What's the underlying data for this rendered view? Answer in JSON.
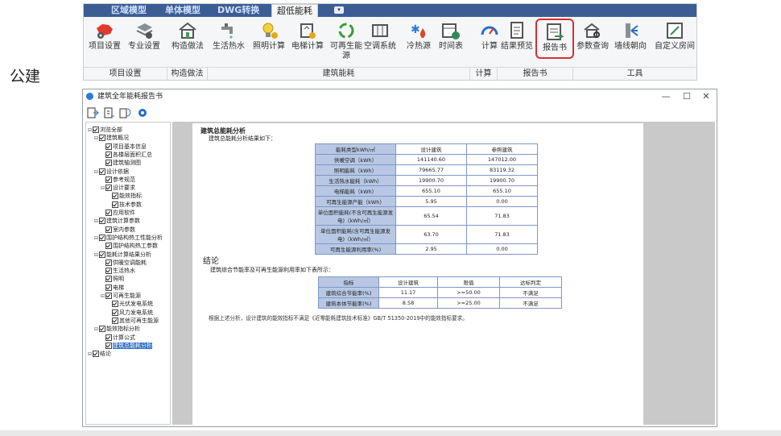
{
  "ribbon": {
    "tabs": [
      "区域模型",
      "单体模型",
      "DWG转换",
      "超低能耗"
    ],
    "buttons": [
      {
        "label": "项目设置",
        "icon": "china-map-gear-icon"
      },
      {
        "label": "专业设置",
        "icon": "layers-gear-icon"
      },
      {
        "label": "构造做法",
        "icon": "house-icon"
      },
      {
        "label": "生活热水",
        "icon": "faucet-icon"
      },
      {
        "label": "照明计算",
        "icon": "bulb-icon"
      },
      {
        "label": "电梯计算",
        "icon": "elevator-icon"
      },
      {
        "label": "可再生能源",
        "icon": "recycle-icon"
      },
      {
        "label": "空调系统",
        "icon": "ac-icon"
      },
      {
        "label": "冷热源",
        "icon": "snow-fire-icon"
      },
      {
        "label": "时间表",
        "icon": "calendar-clock-icon"
      },
      {
        "label": "计算",
        "icon": "gauge-icon"
      },
      {
        "label": "结果预览",
        "icon": "preview-icon"
      },
      {
        "label": "报告书",
        "icon": "report-icon"
      },
      {
        "label": "参数查询",
        "icon": "house-search-icon"
      },
      {
        "label": "墙线朝向",
        "icon": "wall-direction-icon"
      },
      {
        "label": "自定义房间",
        "icon": "custom-room-icon"
      }
    ],
    "groups": [
      "项目设置",
      "构造做法",
      "建筑能耗",
      "计算",
      "报告书",
      "工具"
    ],
    "extra_tab": "▾"
  },
  "side_label": "公建",
  "window": {
    "title": "建筑全年能耗报告书",
    "controls": [
      "—",
      "☐",
      "✕"
    ],
    "tree": [
      {
        "label": "浏览全部",
        "lvl": 0,
        "exp": "⊟"
      },
      {
        "label": "建筑概况",
        "lvl": 1,
        "exp": "⊟"
      },
      {
        "label": "项目基本信息",
        "lvl": 2
      },
      {
        "label": "各楼层面积汇总",
        "lvl": 2
      },
      {
        "label": "建筑轴测图",
        "lvl": 2
      },
      {
        "label": "设计依据",
        "lvl": 1,
        "exp": "⊟"
      },
      {
        "label": "参考规范",
        "lvl": 2
      },
      {
        "label": "设计要求",
        "lvl": 2,
        "exp": "⊟"
      },
      {
        "label": "能效指标",
        "lvl": 3
      },
      {
        "label": "技术参数",
        "lvl": 3
      },
      {
        "label": "应用软件",
        "lvl": 2
      },
      {
        "label": "建筑计算参数",
        "lvl": 1,
        "exp": "⊟"
      },
      {
        "label": "室内参数",
        "lvl": 2
      },
      {
        "label": "围护结构热工性能分析",
        "lvl": 1,
        "exp": "⊟"
      },
      {
        "label": "围护结构热工参数",
        "lvl": 2
      },
      {
        "label": "能耗计算结果分析",
        "lvl": 1,
        "exp": "⊟"
      },
      {
        "label": "供暖空调能耗",
        "lvl": 2
      },
      {
        "label": "生活热水",
        "lvl": 2
      },
      {
        "label": "照明",
        "lvl": 2
      },
      {
        "label": "电梯",
        "lvl": 2
      },
      {
        "label": "可再生能源",
        "lvl": 2,
        "exp": "⊟"
      },
      {
        "label": "光伏发电系统",
        "lvl": 3
      },
      {
        "label": "风力发电系统",
        "lvl": 3
      },
      {
        "label": "其他可再生能源",
        "lvl": 3
      },
      {
        "label": "能效指标分析",
        "lvl": 1,
        "exp": "⊟"
      },
      {
        "label": "计算公式",
        "lvl": 2
      },
      {
        "label": "建筑总能耗分析",
        "lvl": 2,
        "selected": true
      },
      {
        "label": "结论",
        "lvl": 0,
        "exp": "⊟"
      }
    ]
  },
  "report": {
    "heading": "建筑总能耗分析",
    "intro": "建筑总能耗分析结果如下：",
    "table1": {
      "header": [
        "能耗类型kWh/㎡",
        "设计建筑",
        "参照建筑"
      ],
      "rows": [
        [
          "供暖空调（kWh）",
          "141140.60",
          "147012.00"
        ],
        [
          "照明能耗（kWh）",
          "79665.77",
          "83119.32"
        ],
        [
          "生活热水能耗（kWh）",
          "19900.70",
          "19900.70"
        ],
        [
          "电梯能耗（kWh）",
          "655.10",
          "655.10"
        ],
        [
          "可再生能源产能（kWh）",
          "5.95",
          "0.00"
        ],
        [
          "单位面积能耗(不含可再生能源发电)（kWh/㎡）",
          "65.54",
          "71.83"
        ],
        [
          "单位面积能耗(含可再生能源发电)（kWh/㎡）",
          "63.70",
          "71.83"
        ],
        [
          "可再生能源利用率(%)",
          "2.95",
          "0.00"
        ]
      ]
    },
    "conclusion_title": "结论",
    "conclusion_intro": "建筑综合节能率及可再生能源利用率如下表所示：",
    "table2": {
      "header": [
        "指标",
        "设计建筑",
        "限值",
        "达标判定"
      ],
      "rows": [
        [
          "建筑综合节能率(%)",
          "11.17",
          ">=50.00",
          "不满足"
        ],
        [
          "建筑本体节能率(%)",
          "8.58",
          ">=25.00",
          "不满足"
        ]
      ]
    },
    "note": "根据上述分析，设计建筑的能效指标不满足《近零能耗建筑技术标准》GB/T 51350-2019中的能效指标要求。"
  }
}
